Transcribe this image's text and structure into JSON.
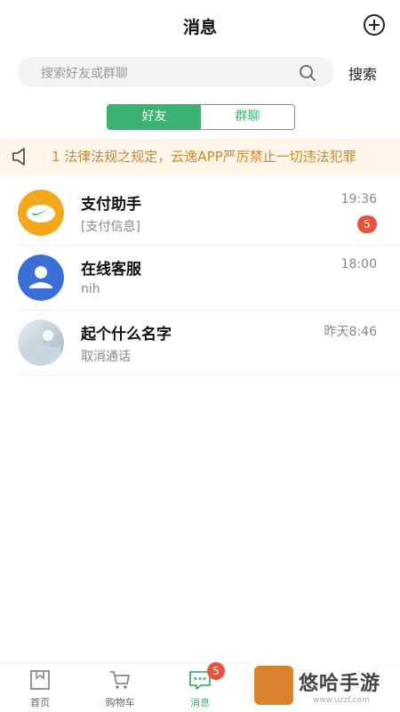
{
  "header": {
    "title": "消息",
    "add_icon": "add-circle-icon"
  },
  "search": {
    "placeholder": "搜索好友或群聊",
    "button": "搜索",
    "icon": "search-icon"
  },
  "segment": {
    "tabs": [
      {
        "label": "好友",
        "active": true
      },
      {
        "label": "群聊",
        "active": false
      }
    ]
  },
  "notice": {
    "icon": "speaker-icon",
    "text": "1 法律法规之规定，云逸APP严厉禁止一切违法犯罪"
  },
  "chats": [
    {
      "name": "支付助手",
      "message": "[支付信息]",
      "time": "19:36",
      "badge": "5",
      "avatar": "payment-logo-avatar"
    },
    {
      "name": "在线客服",
      "message": "nih",
      "time": "18:00",
      "badge": "",
      "avatar": "customer-service-avatar"
    },
    {
      "name": "起个什么名字",
      "message": "取消通话",
      "time": "昨天8:46",
      "badge": "",
      "avatar": "photo-avatar"
    }
  ],
  "tabbar": {
    "items": [
      {
        "label": "首页",
        "icon": "home-icon",
        "active": false
      },
      {
        "label": "购物车",
        "icon": "cart-icon",
        "active": false
      },
      {
        "label": "消息",
        "icon": "message-icon",
        "active": true,
        "badge": "5"
      },
      {
        "label": "",
        "icon": "contacts-icon",
        "active": false
      },
      {
        "label": "",
        "icon": "profile-icon",
        "active": false
      }
    ]
  },
  "watermark": {
    "text": "悠哈手游",
    "sub": "www.uzzf.com"
  },
  "colors": {
    "accent": "#3cb371",
    "badge": "#e8533c",
    "notice_bg": "#fdf5e8",
    "notice_text": "#c98a2e"
  }
}
